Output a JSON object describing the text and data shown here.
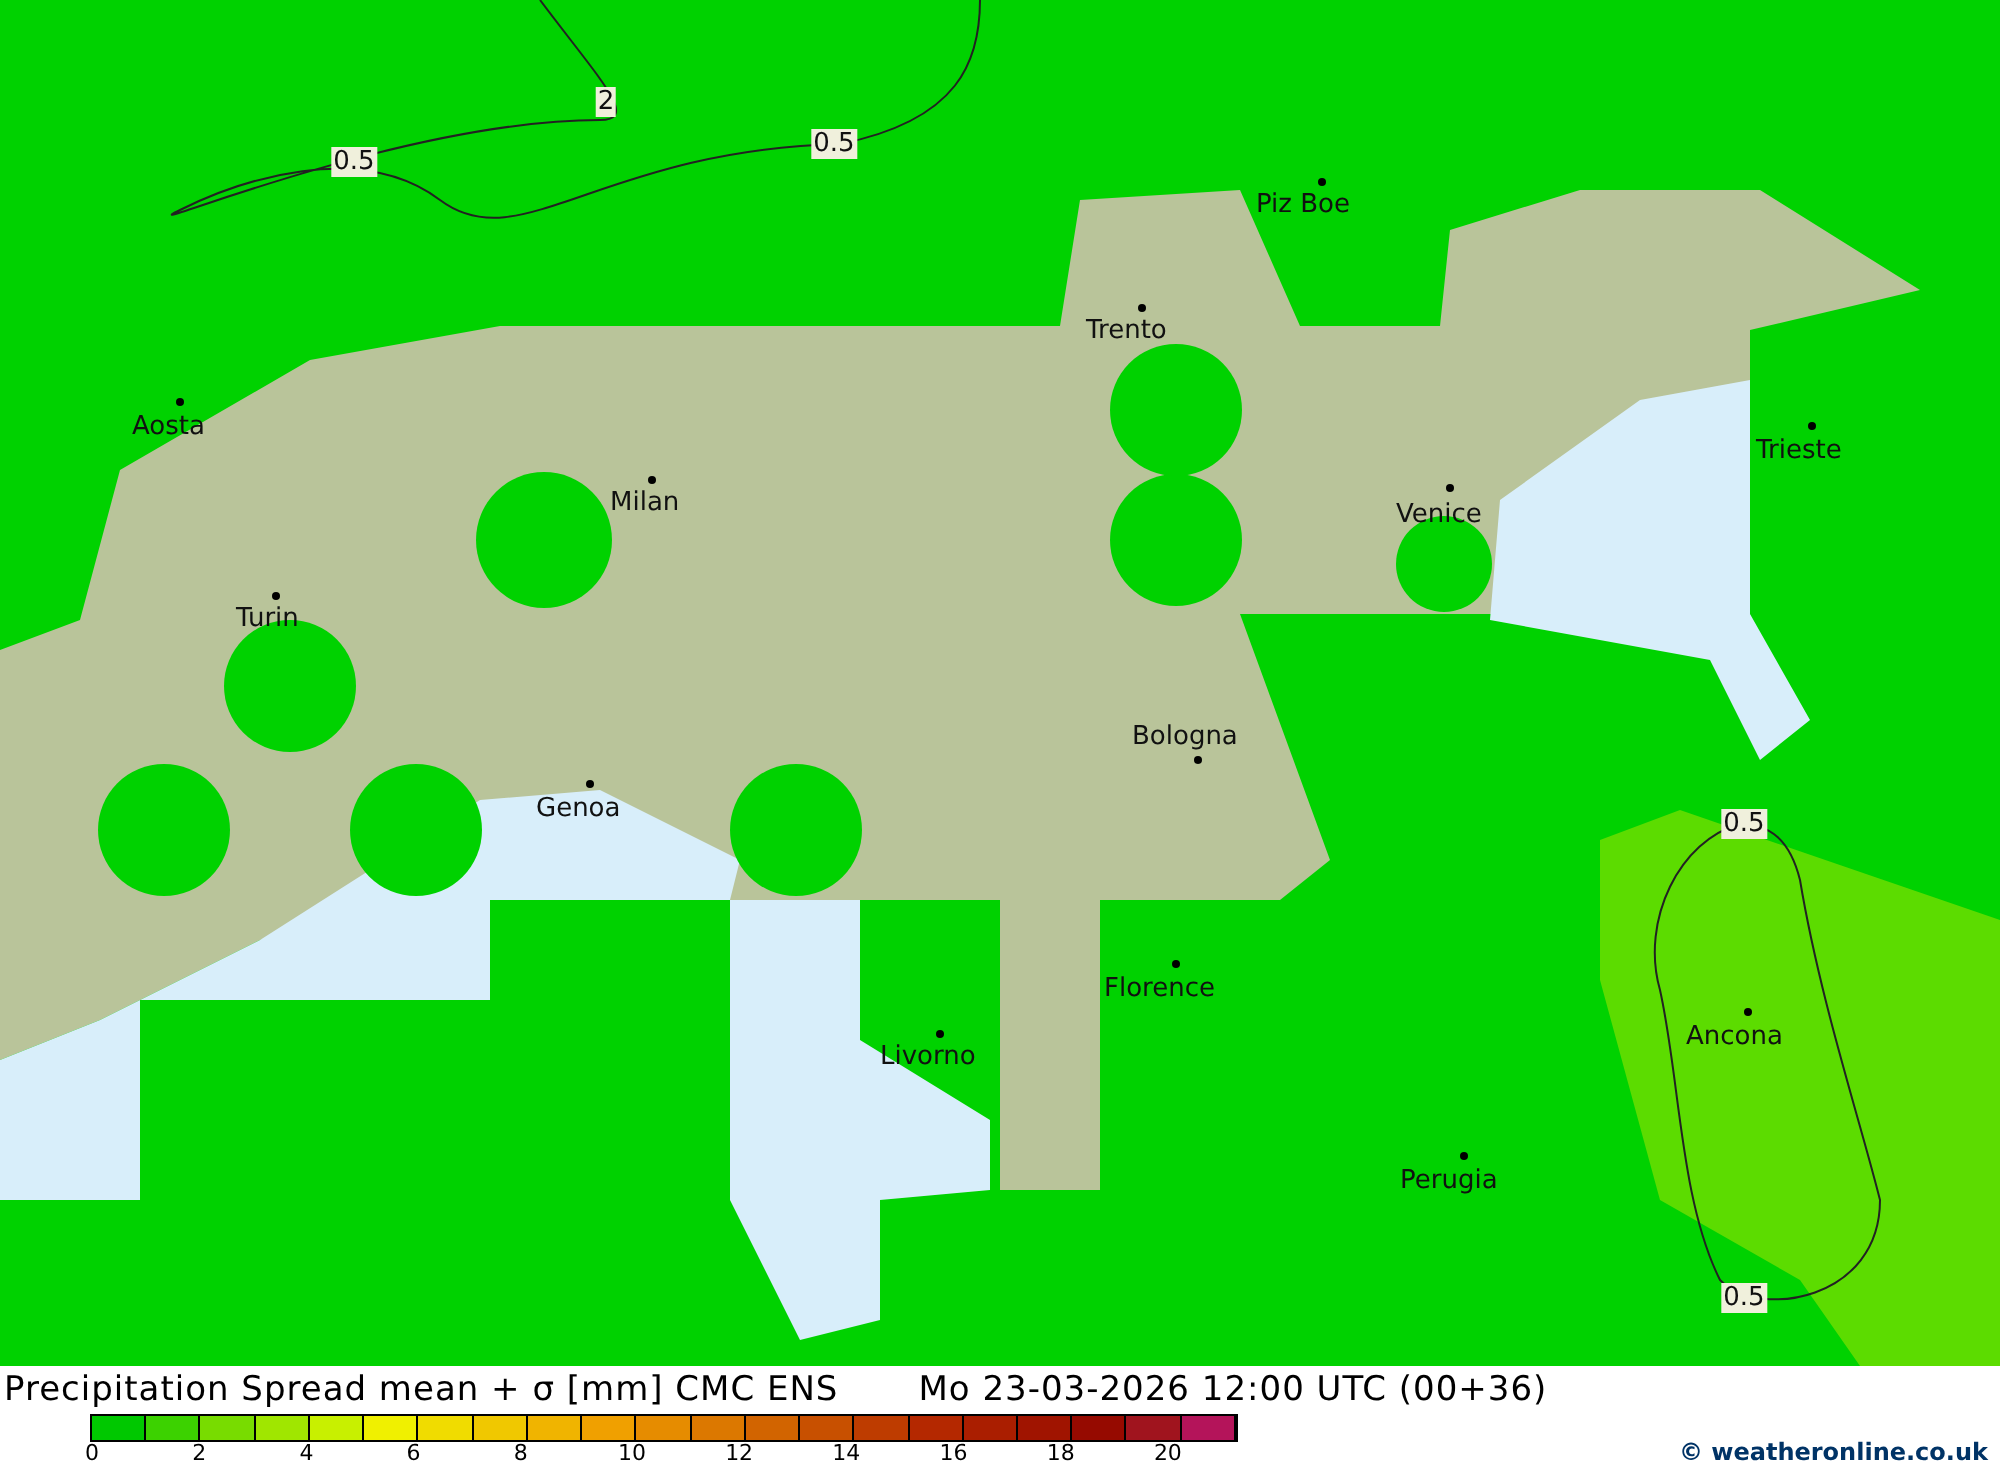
{
  "map": {
    "cities": [
      {
        "name": "Piz Boe"
      },
      {
        "name": "Trento"
      },
      {
        "name": "Aosta"
      },
      {
        "name": "Trieste"
      },
      {
        "name": "Milan"
      },
      {
        "name": "Venice"
      },
      {
        "name": "Turin"
      },
      {
        "name": "Bologna"
      },
      {
        "name": "Genoa"
      },
      {
        "name": "Florence"
      },
      {
        "name": "Livorno"
      },
      {
        "name": "Ancona"
      },
      {
        "name": "Perugia"
      }
    ],
    "contour_labels": [
      {
        "text": "2"
      },
      {
        "text": "0.5"
      },
      {
        "text": "0.5"
      },
      {
        "text": "0.5"
      },
      {
        "text": "0.5"
      }
    ]
  },
  "title": "Precipitation Spread mean + σ [mm] CMC ENS",
  "datetime": "Mo 23-03-2026 12:00 UTC (00+36)",
  "legend": {
    "colors": [
      {
        "color": "#00c800"
      },
      {
        "color": "#3cd200"
      },
      {
        "color": "#78dc00"
      },
      {
        "color": "#a0e600"
      },
      {
        "color": "#c8f000"
      },
      {
        "color": "#f0f000"
      },
      {
        "color": "#f0dc00"
      },
      {
        "color": "#f0c800"
      },
      {
        "color": "#f0b400"
      },
      {
        "color": "#f0a000"
      },
      {
        "color": "#e68c00"
      },
      {
        "color": "#dc7800"
      },
      {
        "color": "#d26400"
      },
      {
        "color": "#c85000"
      },
      {
        "color": "#be3c00"
      },
      {
        "color": "#b42800"
      },
      {
        "color": "#aa1e00"
      },
      {
        "color": "#a01400"
      },
      {
        "color": "#960a00"
      },
      {
        "color": "#a0141e"
      },
      {
        "color": "#b4145a"
      }
    ],
    "ticks": [
      "0",
      "2",
      "4",
      "6",
      "8",
      "10",
      "12",
      "14",
      "16",
      "18",
      "20"
    ]
  },
  "credit": "© weatheronline.co.uk"
}
